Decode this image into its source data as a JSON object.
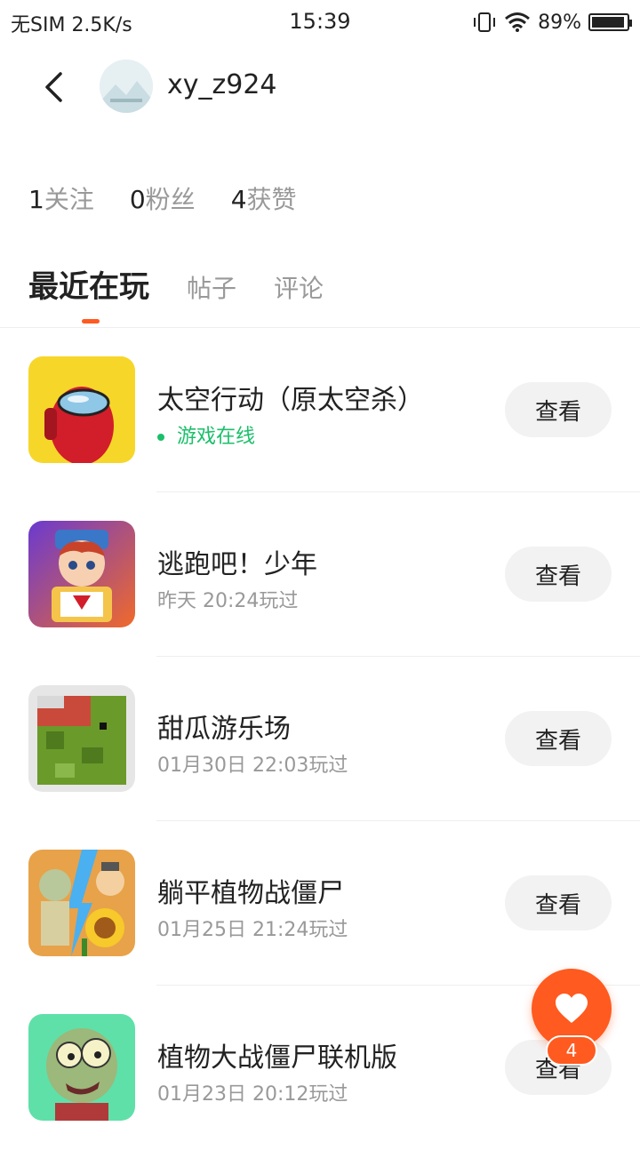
{
  "status_bar": {
    "carrier": "无SIM",
    "speed": "2.5K/s",
    "time": "15:39",
    "battery": "89%",
    "icons": [
      "vibrate-icon",
      "wifi-icon",
      "battery-icon"
    ]
  },
  "profile": {
    "username": "xy_z924"
  },
  "stats": [
    {
      "num": "1",
      "label": "关注"
    },
    {
      "num": "0",
      "label": "粉丝"
    },
    {
      "num": "4",
      "label": "获赞"
    }
  ],
  "tabs": [
    {
      "label": "最近在玩",
      "active": true
    },
    {
      "label": "帖子",
      "active": false
    },
    {
      "label": "评论",
      "active": false
    }
  ],
  "games": [
    {
      "name": "太空行动（原太空杀）",
      "status": "游戏在线",
      "online": true,
      "button": "查看",
      "icon": "among-us-icon"
    },
    {
      "name": "逃跑吧！少年",
      "status": "昨天 20:24玩过",
      "online": false,
      "button": "查看",
      "icon": "escape-boy-icon"
    },
    {
      "name": "甜瓜游乐场",
      "status": "01月30日 22:03玩过",
      "online": false,
      "button": "查看",
      "icon": "melon-playground-icon"
    },
    {
      "name": "躺平植物战僵尸",
      "status": "01月25日 21:24玩过",
      "online": false,
      "button": "查看",
      "icon": "pvz-lying-icon"
    },
    {
      "name": "植物大战僵尸联机版",
      "status": "01月23日 20:12玩过",
      "online": false,
      "button": "查看",
      "icon": "pvz-online-icon"
    }
  ],
  "fab": {
    "count": "4",
    "color": "#ff5a1f"
  },
  "colors": {
    "accent": "#ff5a1f",
    "online": "#1bbf6a",
    "secondary_text": "#999999"
  }
}
